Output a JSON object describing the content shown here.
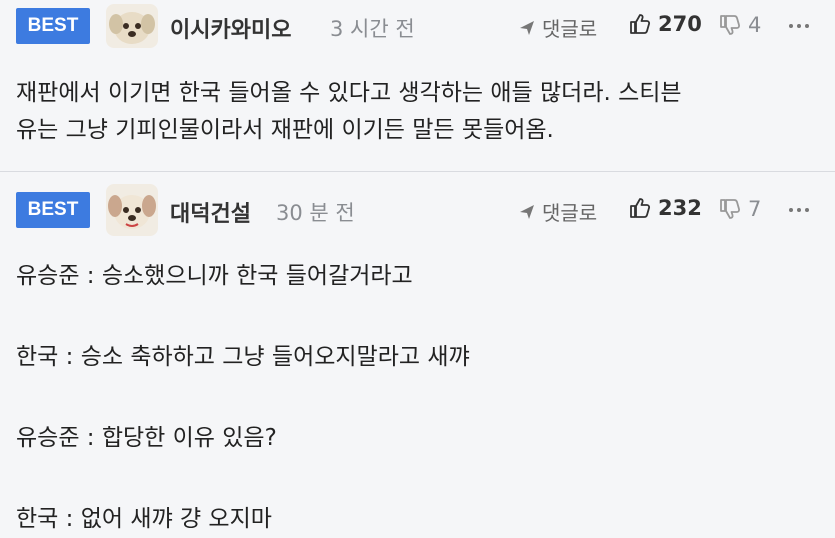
{
  "comments": [
    {
      "badge": "BEST",
      "nickname": "이시카와미오",
      "time": "3 시간 전",
      "reply_label": "댓글로",
      "likes": "270",
      "dislikes": "4",
      "lines": [
        "재판에서 이기면 한국 들어올 수 있다고 생각하는 애들 많더라. 스티븐",
        "유는 그냥 기피인물이라서 재판에 이기든 말든 못들어옴."
      ]
    },
    {
      "badge": "BEST",
      "nickname": "대덕건설",
      "time": "30 분 전",
      "reply_label": "댓글로",
      "likes": "232",
      "dislikes": "7",
      "lines": [
        "유승준 : 승소했으니까 한국 들어갈거라고",
        "한국 : 승소 축하하고 그냥 들어오지말라고 새꺄",
        "유승준 : 합당한 이유 있음?",
        "한국 : 없어 새꺄 걍 오지마"
      ]
    }
  ],
  "colors": {
    "badge": "#3d7be0",
    "background": "#f5f6f8",
    "divider": "#d9dbe0"
  },
  "icons": [
    "avatar-dog",
    "reply-arrow-icon",
    "thumbs-up-icon",
    "thumbs-down-icon",
    "more-dots-icon"
  ]
}
